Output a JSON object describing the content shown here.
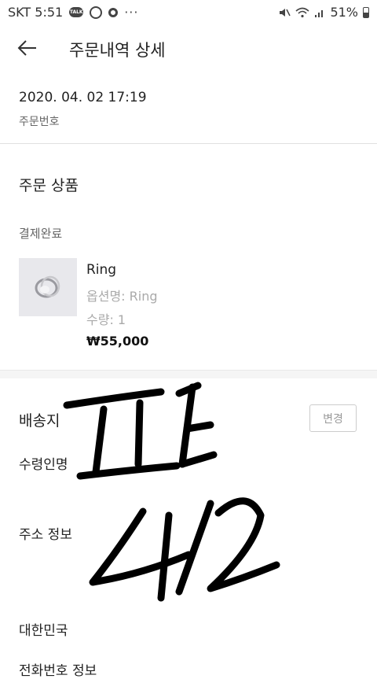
{
  "status_bar": {
    "carrier_time": "SKT 5:51",
    "talk_badge": "TALK",
    "more": "···",
    "battery": "51%"
  },
  "header": {
    "title": "주문내역 상세"
  },
  "order": {
    "date": "2020. 04. 02 17:19",
    "number_label": "주문번호"
  },
  "products_section": {
    "title": "주문 상품",
    "payment_status": "결제완료",
    "item": {
      "name": "Ring",
      "option": "옵션명: Ring",
      "quantity": "수량: 1",
      "price": "₩55,000"
    }
  },
  "shipping": {
    "title": "배송지",
    "change_button": "변경",
    "recipient_label": "수령인명",
    "address_label": "주소 정보",
    "country": "대한민국",
    "phone_label": "전화번호 정보"
  },
  "handwriting_text": "파트 4/2"
}
